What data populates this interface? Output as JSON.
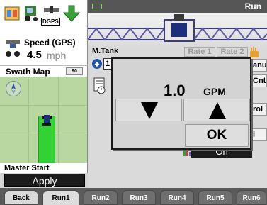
{
  "icons": [
    "field-setup-icon",
    "tractor-icon",
    "gps-icon",
    "down-arrow-icon"
  ],
  "gps_label": "DGPS",
  "speed": {
    "label": "Speed (GPS)",
    "value": "4.5",
    "unit": "mph"
  },
  "swath_map": {
    "title": "Swath Map",
    "zoom": "90"
  },
  "master_start": {
    "label": "Master Start",
    "button": "Apply"
  },
  "status": {
    "run_title": "Run"
  },
  "product": {
    "label": "M.Tank",
    "indicator": "1",
    "rate_tabs": [
      "Rate 1",
      "Rate 2"
    ]
  },
  "background_tabs": [
    "anu",
    "Cnt",
    "rol",
    "l"
  ],
  "background_toggle": "On",
  "dialog": {
    "rate_value": "1.0",
    "rate_unit": "GPM",
    "ok_label": "OK"
  },
  "tabs": [
    "Back",
    "Run1",
    "Run2",
    "Run3",
    "Run4",
    "Run5",
    "Run6"
  ],
  "colors": {
    "swath_green": "#33d133",
    "map_background": "#b9d7a0",
    "status_bar": "#565656",
    "tab_bar": "#5a5a5a"
  }
}
